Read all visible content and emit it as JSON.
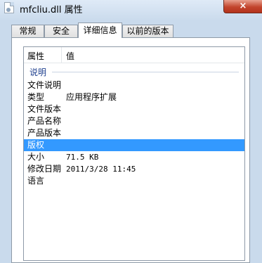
{
  "window": {
    "title": "mfcliu.dll 属性",
    "close_symbol": "×"
  },
  "tabs": [
    {
      "label": "常规"
    },
    {
      "label": "安全"
    },
    {
      "label": "详细信息",
      "active": true
    },
    {
      "label": "以前的版本"
    }
  ],
  "details": {
    "columns": {
      "property": "属性",
      "value": "值"
    },
    "group": "说明",
    "rows": [
      {
        "property": "文件说明",
        "value": ""
      },
      {
        "property": "类型",
        "value": "应用程序扩展"
      },
      {
        "property": "文件版本",
        "value": ""
      },
      {
        "property": "产品名称",
        "value": ""
      },
      {
        "property": "产品版本",
        "value": ""
      },
      {
        "property": "版权",
        "value": "",
        "selected": true
      },
      {
        "property": "大小",
        "value": "71.5 KB"
      },
      {
        "property": "修改日期",
        "value": "2011/3/28 11:45"
      },
      {
        "property": "语言",
        "value": ""
      }
    ]
  },
  "colors": {
    "selection": "#3399ff",
    "group_label": "#1e3f8e",
    "close_button": "#c2452d"
  }
}
